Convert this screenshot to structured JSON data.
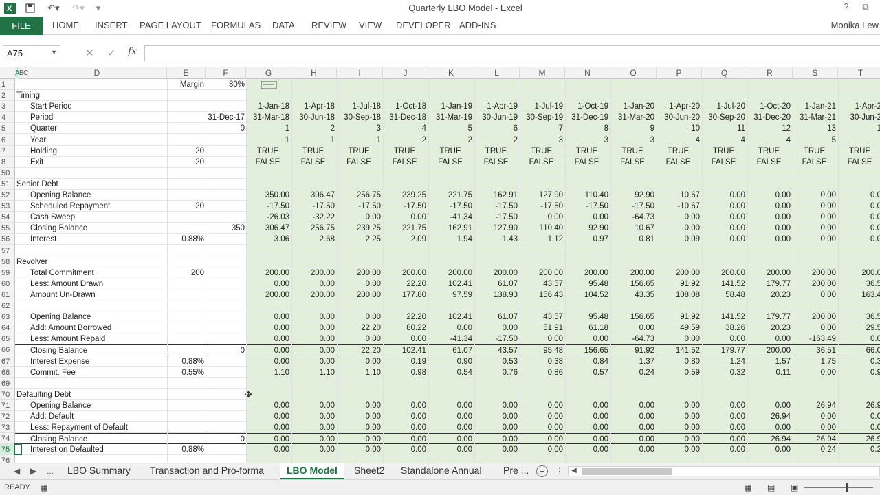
{
  "window": {
    "title": "Quarterly LBO Model - Excel",
    "user": "Monika Lew",
    "help": "?",
    "restore": "⧉"
  },
  "ribbon": {
    "file": "FILE",
    "tabs": [
      "HOME",
      "INSERT",
      "PAGE LAYOUT",
      "FORMULAS",
      "DATA",
      "REVIEW",
      "VIEW",
      "DEVELOPER",
      "ADD-INS"
    ]
  },
  "formula_bar": {
    "name_box": "A75",
    "fx": "fx",
    "content": ""
  },
  "columns": [
    "A",
    "B",
    "C",
    "D",
    "E",
    "F",
    "G",
    "H",
    "I",
    "J",
    "K",
    "L",
    "M",
    "N",
    "O",
    "P",
    "Q",
    "R",
    "S",
    "T"
  ],
  "rows": [
    {
      "num": "1",
      "d": "",
      "e": "Margin",
      "f": "80%",
      "v": []
    },
    {
      "num": "2",
      "label_a": "Timing",
      "d": "",
      "e": "",
      "f": "",
      "v": []
    },
    {
      "num": "3",
      "d": "Start Period",
      "e": "",
      "f": "",
      "v": [
        "1-Jan-18",
        "1-Apr-18",
        "1-Jul-18",
        "1-Oct-18",
        "1-Jan-19",
        "1-Apr-19",
        "1-Jul-19",
        "1-Oct-19",
        "1-Jan-20",
        "1-Apr-20",
        "1-Jul-20",
        "1-Oct-20",
        "1-Jan-21",
        "1-Apr-2"
      ]
    },
    {
      "num": "4",
      "d": "Period",
      "e": "",
      "f": "31-Dec-17",
      "v": [
        "31-Mar-18",
        "30-Jun-18",
        "30-Sep-18",
        "31-Dec-18",
        "31-Mar-19",
        "30-Jun-19",
        "30-Sep-19",
        "31-Dec-19",
        "31-Mar-20",
        "30-Jun-20",
        "30-Sep-20",
        "31-Dec-20",
        "31-Mar-21",
        "30-Jun-2"
      ]
    },
    {
      "num": "5",
      "d": "Quarter",
      "e": "",
      "f": "0",
      "v": [
        "1",
        "2",
        "3",
        "4",
        "5",
        "6",
        "7",
        "8",
        "9",
        "10",
        "11",
        "12",
        "13",
        "1"
      ]
    },
    {
      "num": "6",
      "d": "Year",
      "e": "",
      "f": "",
      "v": [
        "1",
        "1",
        "1",
        "2",
        "2",
        "2",
        "3",
        "3",
        "3",
        "4",
        "4",
        "4",
        "5",
        ""
      ]
    },
    {
      "num": "7",
      "d": "Holding",
      "e": "20",
      "f": "",
      "v": [
        "TRUE",
        "TRUE",
        "TRUE",
        "TRUE",
        "TRUE",
        "TRUE",
        "TRUE",
        "TRUE",
        "TRUE",
        "TRUE",
        "TRUE",
        "TRUE",
        "TRUE",
        "TRUE"
      ],
      "center": true
    },
    {
      "num": "8",
      "d": "Exit",
      "e": "20",
      "f": "",
      "v": [
        "FALSE",
        "FALSE",
        "FALSE",
        "FALSE",
        "FALSE",
        "FALSE",
        "FALSE",
        "FALSE",
        "FALSE",
        "FALSE",
        "FALSE",
        "FALSE",
        "FALSE",
        "FALSE"
      ],
      "center": true
    },
    {
      "num": "50",
      "d": "",
      "e": "",
      "f": "",
      "v": []
    },
    {
      "num": "51",
      "label_a": "Senior Debt",
      "d": "",
      "e": "",
      "f": "",
      "v": []
    },
    {
      "num": "52",
      "d": "Opening Balance",
      "e": "",
      "f": "",
      "v": [
        "350.00",
        "306.47",
        "256.75",
        "239.25",
        "221.75",
        "162.91",
        "127.90",
        "110.40",
        "92.90",
        "10.67",
        "0.00",
        "0.00",
        "0.00",
        "0.0"
      ]
    },
    {
      "num": "53",
      "d": "Scheduled Repayment",
      "e": "20",
      "f": "",
      "v": [
        "-17.50",
        "-17.50",
        "-17.50",
        "-17.50",
        "-17.50",
        "-17.50",
        "-17.50",
        "-17.50",
        "-17.50",
        "-10.67",
        "0.00",
        "0.00",
        "0.00",
        "0.0"
      ]
    },
    {
      "num": "54",
      "d": "Cash Sweep",
      "e": "",
      "f": "",
      "v": [
        "-26.03",
        "-32.22",
        "0.00",
        "0.00",
        "-41.34",
        "-17.50",
        "0.00",
        "0.00",
        "-64.73",
        "0.00",
        "0.00",
        "0.00",
        "0.00",
        "0.0"
      ]
    },
    {
      "num": "55",
      "d": "Closing Balance",
      "e": "",
      "f": "350",
      "v": [
        "306.47",
        "256.75",
        "239.25",
        "221.75",
        "162.91",
        "127.90",
        "110.40",
        "92.90",
        "10.67",
        "0.00",
        "0.00",
        "0.00",
        "0.00",
        "0.0"
      ]
    },
    {
      "num": "56",
      "d": "Interest",
      "e": "0.88%",
      "f": "",
      "v": [
        "3.06",
        "2.68",
        "2.25",
        "2.09",
        "1.94",
        "1.43",
        "1.12",
        "0.97",
        "0.81",
        "0.09",
        "0.00",
        "0.00",
        "0.00",
        "0.0"
      ]
    },
    {
      "num": "57",
      "d": "",
      "e": "",
      "f": "",
      "v": []
    },
    {
      "num": "58",
      "label_a": "Revolver",
      "d": "",
      "e": "",
      "f": "",
      "v": []
    },
    {
      "num": "59",
      "d": "Total Commitment",
      "e": "200",
      "f": "",
      "v": [
        "200.00",
        "200.00",
        "200.00",
        "200.00",
        "200.00",
        "200.00",
        "200.00",
        "200.00",
        "200.00",
        "200.00",
        "200.00",
        "200.00",
        "200.00",
        "200.0"
      ]
    },
    {
      "num": "60",
      "d": "Less: Amount Drawn",
      "e": "",
      "f": "",
      "v": [
        "0.00",
        "0.00",
        "0.00",
        "22.20",
        "102.41",
        "61.07",
        "43.57",
        "95.48",
        "156.65",
        "91.92",
        "141.52",
        "179.77",
        "200.00",
        "36.5"
      ]
    },
    {
      "num": "61",
      "d": "Amount Un-Drawn",
      "e": "",
      "f": "",
      "v": [
        "200.00",
        "200.00",
        "200.00",
        "177.80",
        "97.59",
        "138.93",
        "156.43",
        "104.52",
        "43.35",
        "108.08",
        "58.48",
        "20.23",
        "0.00",
        "163.4"
      ]
    },
    {
      "num": "62",
      "d": "",
      "e": "",
      "f": "",
      "v": []
    },
    {
      "num": "63",
      "d": "Opening Balance",
      "e": "",
      "f": "",
      "v": [
        "0.00",
        "0.00",
        "0.00",
        "22.20",
        "102.41",
        "61.07",
        "43.57",
        "95.48",
        "156.65",
        "91.92",
        "141.52",
        "179.77",
        "200.00",
        "36.5"
      ]
    },
    {
      "num": "64",
      "d": "Add: Amount Borrowed",
      "e": "",
      "f": "",
      "v": [
        "0.00",
        "0.00",
        "22.20",
        "80.22",
        "0.00",
        "0.00",
        "51.91",
        "61.18",
        "0.00",
        "49.59",
        "38.26",
        "20.23",
        "0.00",
        "29.5"
      ]
    },
    {
      "num": "65",
      "d": "Less: Amount Repaid",
      "e": "",
      "f": "",
      "v": [
        "0.00",
        "0.00",
        "0.00",
        "0.00",
        "-41.34",
        "-17.50",
        "0.00",
        "0.00",
        "-64.73",
        "0.00",
        "0.00",
        "0.00",
        "-163.49",
        "0.0"
      ]
    },
    {
      "num": "66",
      "d": "Closing Balance",
      "e": "",
      "f": "0",
      "v": [
        "0.00",
        "0.00",
        "22.20",
        "102.41",
        "61.07",
        "43.57",
        "95.48",
        "156.65",
        "91.92",
        "141.52",
        "179.77",
        "200.00",
        "36.51",
        "66.0"
      ],
      "boxed": true
    },
    {
      "num": "67",
      "d": "Interest Expense",
      "e": "0.88%",
      "f": "",
      "v": [
        "0.00",
        "0.00",
        "0.00",
        "0.19",
        "0.90",
        "0.53",
        "0.38",
        "0.84",
        "1.37",
        "0.80",
        "1.24",
        "1.57",
        "1.75",
        "0.3"
      ]
    },
    {
      "num": "68",
      "d": "Commit. Fee",
      "e": "0.55%",
      "f": "",
      "v": [
        "1.10",
        "1.10",
        "1.10",
        "0.98",
        "0.54",
        "0.76",
        "0.86",
        "0.57",
        "0.24",
        "0.59",
        "0.32",
        "0.11",
        "0.00",
        "0.9"
      ]
    },
    {
      "num": "69",
      "d": "",
      "e": "",
      "f": "",
      "v": []
    },
    {
      "num": "70",
      "label_a": "Defaulting Debt",
      "d": "",
      "e": "",
      "f": "",
      "v": []
    },
    {
      "num": "71",
      "d": "Opening Balance",
      "e": "",
      "f": "",
      "v": [
        "0.00",
        "0.00",
        "0.00",
        "0.00",
        "0.00",
        "0.00",
        "0.00",
        "0.00",
        "0.00",
        "0.00",
        "0.00",
        "0.00",
        "26.94",
        "26.9"
      ]
    },
    {
      "num": "72",
      "d": "Add: Default",
      "e": "",
      "f": "",
      "v": [
        "0.00",
        "0.00",
        "0.00",
        "0.00",
        "0.00",
        "0.00",
        "0.00",
        "0.00",
        "0.00",
        "0.00",
        "0.00",
        "26.94",
        "0.00",
        "0.0"
      ]
    },
    {
      "num": "73",
      "d": "Less: Repayment of Default",
      "e": "",
      "f": "",
      "v": [
        "0.00",
        "0.00",
        "0.00",
        "0.00",
        "0.00",
        "0.00",
        "0.00",
        "0.00",
        "0.00",
        "0.00",
        "0.00",
        "0.00",
        "0.00",
        "0.0"
      ]
    },
    {
      "num": "74",
      "d": "Closing Balance",
      "e": "",
      "f": "0",
      "v": [
        "0.00",
        "0.00",
        "0.00",
        "0.00",
        "0.00",
        "0.00",
        "0.00",
        "0.00",
        "0.00",
        "0.00",
        "0.00",
        "26.94",
        "26.94",
        "26.9"
      ],
      "boxed": true
    },
    {
      "num": "75",
      "d": "Interest on Defaulted",
      "e": "0.88%",
      "f": "",
      "v": [
        "0.00",
        "0.00",
        "0.00",
        "0.00",
        "0.00",
        "0.00",
        "0.00",
        "0.00",
        "0.00",
        "0.00",
        "0.00",
        "0.00",
        "0.24",
        "0.2"
      ],
      "selected": true
    },
    {
      "num": "76",
      "d": "",
      "e": "",
      "f": "",
      "v": []
    }
  ],
  "sheet_tabs": [
    "LBO Summary",
    "Transaction and Pro-forma",
    "LBO Model",
    "Sheet2",
    "Standalone Annual",
    "Pre ..."
  ],
  "active_sheet": "LBO Model",
  "tab_nav_more": "...",
  "status": {
    "text": "READY"
  }
}
